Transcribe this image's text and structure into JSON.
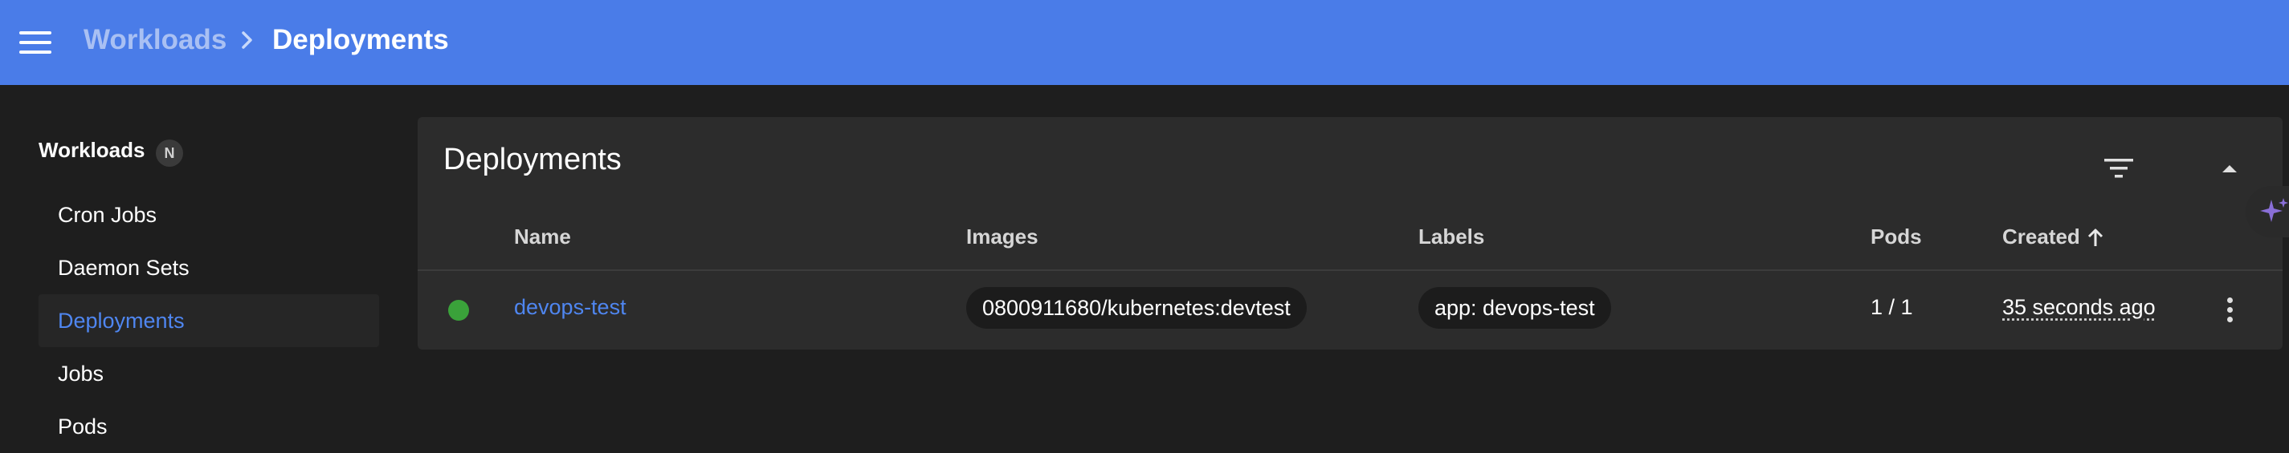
{
  "header": {
    "breadcrumb_parent": "Workloads",
    "breadcrumb_current": "Deployments"
  },
  "sidebar": {
    "heading": "Workloads",
    "namespace_badge": "N",
    "items": [
      {
        "label": "Cron Jobs"
      },
      {
        "label": "Daemon Sets"
      },
      {
        "label": "Deployments"
      },
      {
        "label": "Jobs"
      },
      {
        "label": "Pods"
      }
    ],
    "active_item": "Deployments"
  },
  "main": {
    "title": "Deployments",
    "columns": {
      "name": "Name",
      "images": "Images",
      "labels": "Labels",
      "pods": "Pods",
      "created": "Created"
    },
    "sort": {
      "column": "Created",
      "direction": "ascending",
      "icon": "arrow-up-icon"
    },
    "rows": [
      {
        "status": "ok",
        "name": "devops-test",
        "image": "0800911680/kubernetes:devtest",
        "label": "app: devops-test",
        "pods": "1 / 1",
        "created": "35 seconds ago"
      }
    ]
  },
  "colors": {
    "topbar": "#4a7ce8",
    "link": "#4f86f0",
    "status_ok": "#3aa23a",
    "background": "#1e1e1e",
    "card": "#2c2c2c"
  },
  "icons": {
    "menu": "menu-icon",
    "breadcrumb_separator": "chevron-right-icon",
    "filter": "filter-icon",
    "collapse": "chevron-up-icon",
    "row_actions": "more-vertical-icon",
    "assistant": "sparkle-icon"
  }
}
